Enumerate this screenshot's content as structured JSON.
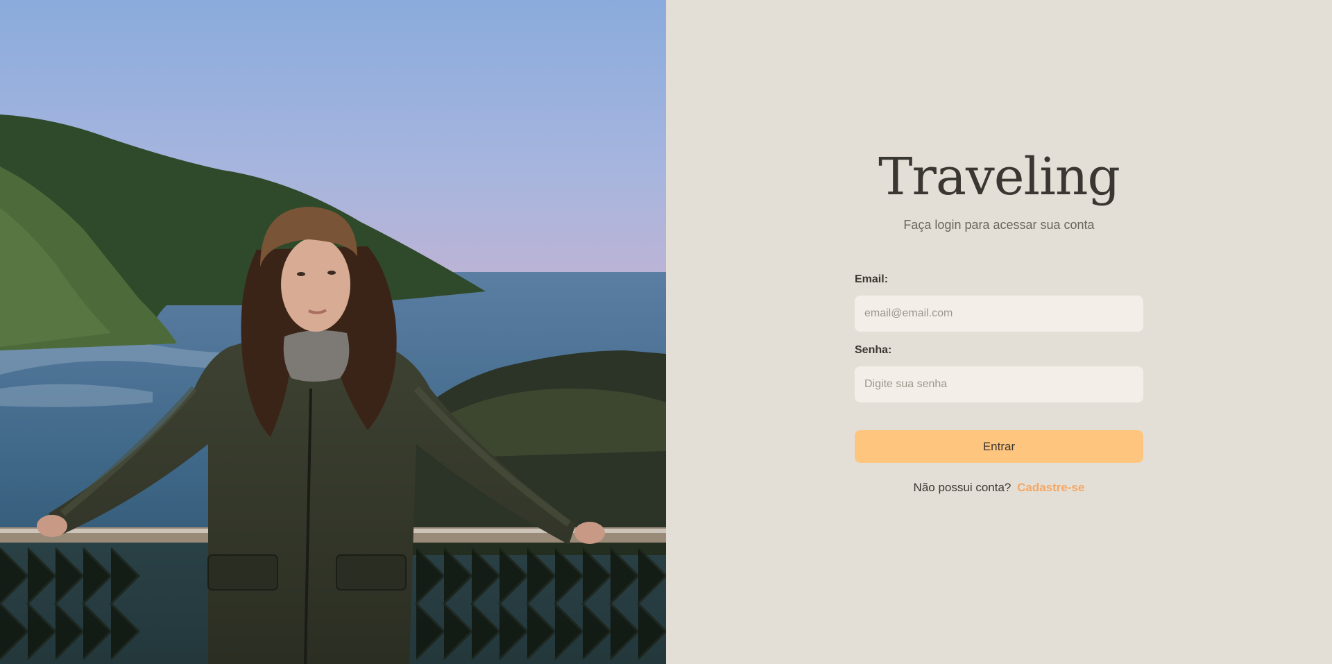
{
  "photo": {
    "alt": "",
    "icon": "hero-photo"
  },
  "brand": {
    "title": "Traveling",
    "subtitle": "Faça login para acessar sua conta"
  },
  "form": {
    "email_label": "Email:",
    "email_placeholder": "email@email.com",
    "email_value": "",
    "password_label": "Senha:",
    "password_placeholder": "Digite sua senha",
    "password_value": "",
    "submit_label": "Entrar"
  },
  "signup": {
    "prompt": "Não possui conta?",
    "link_label": "Cadastre-se"
  },
  "colors": {
    "panel_background": "#e4dfd6",
    "input_background": "#f3efe8",
    "button_background": "#fec57f",
    "link_color": "#f4a765",
    "text_color": "#3a3631"
  }
}
